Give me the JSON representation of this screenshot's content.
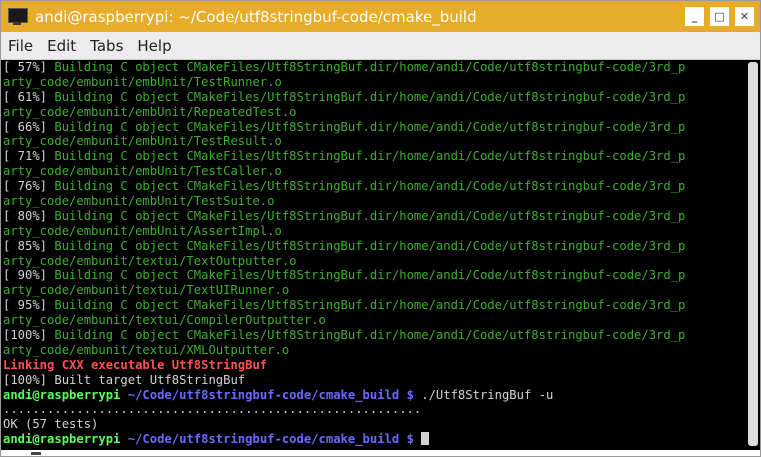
{
  "window": {
    "title": "andi@raspberrypi: ~/Code/utf8stringbuf-code/cmake_build",
    "buttons": {
      "minimize": "_",
      "maximize": "□",
      "close": "✕"
    }
  },
  "menu": [
    "File",
    "Edit",
    "Tabs",
    "Help"
  ],
  "terminal": {
    "build_lines": [
      {
        "pct": "[ 57%]",
        "text": " Building C object CMakeFiles/Utf8StringBuf.dir/home/andi/Code/utf8stringbuf-code/3rd_p",
        "cont": "arty_code/embunit/embUnit/TestRunner.o"
      },
      {
        "pct": "[ 61%]",
        "text": " Building C object CMakeFiles/Utf8StringBuf.dir/home/andi/Code/utf8stringbuf-code/3rd_p",
        "cont": "arty_code/embunit/embUnit/RepeatedTest.o"
      },
      {
        "pct": "[ 66%]",
        "text": " Building C object CMakeFiles/Utf8StringBuf.dir/home/andi/Code/utf8stringbuf-code/3rd_p",
        "cont": "arty_code/embunit/embUnit/TestResult.o"
      },
      {
        "pct": "[ 71%]",
        "text": " Building C object CMakeFiles/Utf8StringBuf.dir/home/andi/Code/utf8stringbuf-code/3rd_p",
        "cont": "arty_code/embunit/embUnit/TestCaller.o"
      },
      {
        "pct": "[ 76%]",
        "text": " Building C object CMakeFiles/Utf8StringBuf.dir/home/andi/Code/utf8stringbuf-code/3rd_p",
        "cont": "arty_code/embunit/embUnit/TestSuite.o"
      },
      {
        "pct": "[ 80%]",
        "text": " Building C object CMakeFiles/Utf8StringBuf.dir/home/andi/Code/utf8stringbuf-code/3rd_p",
        "cont": "arty_code/embunit/embUnit/AssertImpl.o"
      },
      {
        "pct": "[ 85%]",
        "text": " Building C object CMakeFiles/Utf8StringBuf.dir/home/andi/Code/utf8stringbuf-code/3rd_p",
        "cont": "arty_code/embunit/textui/TextOutputter.o"
      },
      {
        "pct": "[ 90%]",
        "text": " Building C object CMakeFiles/Utf8StringBuf.dir/home/andi/Code/utf8stringbuf-code/3rd_p",
        "cont": "arty_code/embunit/textui/TextUIRunner.o"
      },
      {
        "pct": "[ 95%]",
        "text": " Building C object CMakeFiles/Utf8StringBuf.dir/home/andi/Code/utf8stringbuf-code/3rd_p",
        "cont": "arty_code/embunit/textui/CompilerOutputter.o"
      },
      {
        "pct": "[100%]",
        "text": " Building C object CMakeFiles/Utf8StringBuf.dir/home/andi/Code/utf8stringbuf-code/3rd_p",
        "cont": "arty_code/embunit/textui/XMLOutputter.o"
      }
    ],
    "linking": "Linking CXX executable Utf8StringBuf",
    "built": "[100%] Built target Utf8StringBuf",
    "prompt_user": "andi@raspberrypi",
    "prompt_path": " ~/Code/utf8stringbuf-code/cmake_build $",
    "command": " ./Utf8StringBuf -u",
    "dots": ".........................................................",
    "result": "OK (57 tests)",
    "prompt2_user": "andi@raspberrypi",
    "prompt2_path": " ~/Code/utf8stringbuf-code/cmake_build $"
  }
}
